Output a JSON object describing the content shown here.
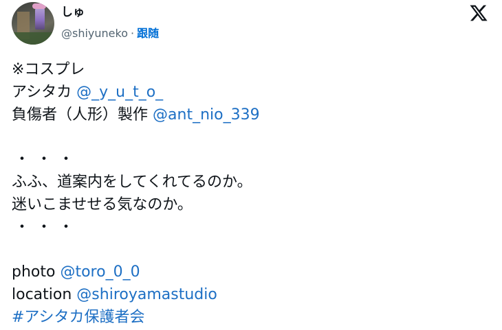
{
  "author": {
    "display_name": "しゅ",
    "handle": "@shiyuneko",
    "separator": "·",
    "follow_label": "跟随"
  },
  "brand": {
    "logo_icon": "x-logo-icon",
    "text_color": "#0f1419",
    "link_color": "#1d6fc4",
    "follow_color": "#006fd6",
    "muted_color": "#536471"
  },
  "tweet": {
    "line1": "※コスプレ",
    "line2_text": "アシタカ",
    "line2_mention": "@_y_u_t_o_",
    "line3_text": "負傷者（人形）製作",
    "line3_mention": "@ant_nio_339",
    "line5_dots": "・・・",
    "line6": "ふふ、道案内をしてくれてるのか。",
    "line7": "迷いこませせる気なのか。",
    "line8_dots": "・・・",
    "line10_text": "photo",
    "line10_mention": "@toro_0_0",
    "line11_text": "location",
    "line11_mention": "@shiroyamastudio",
    "line12_hashtag": "#アシタカ保護者会"
  }
}
